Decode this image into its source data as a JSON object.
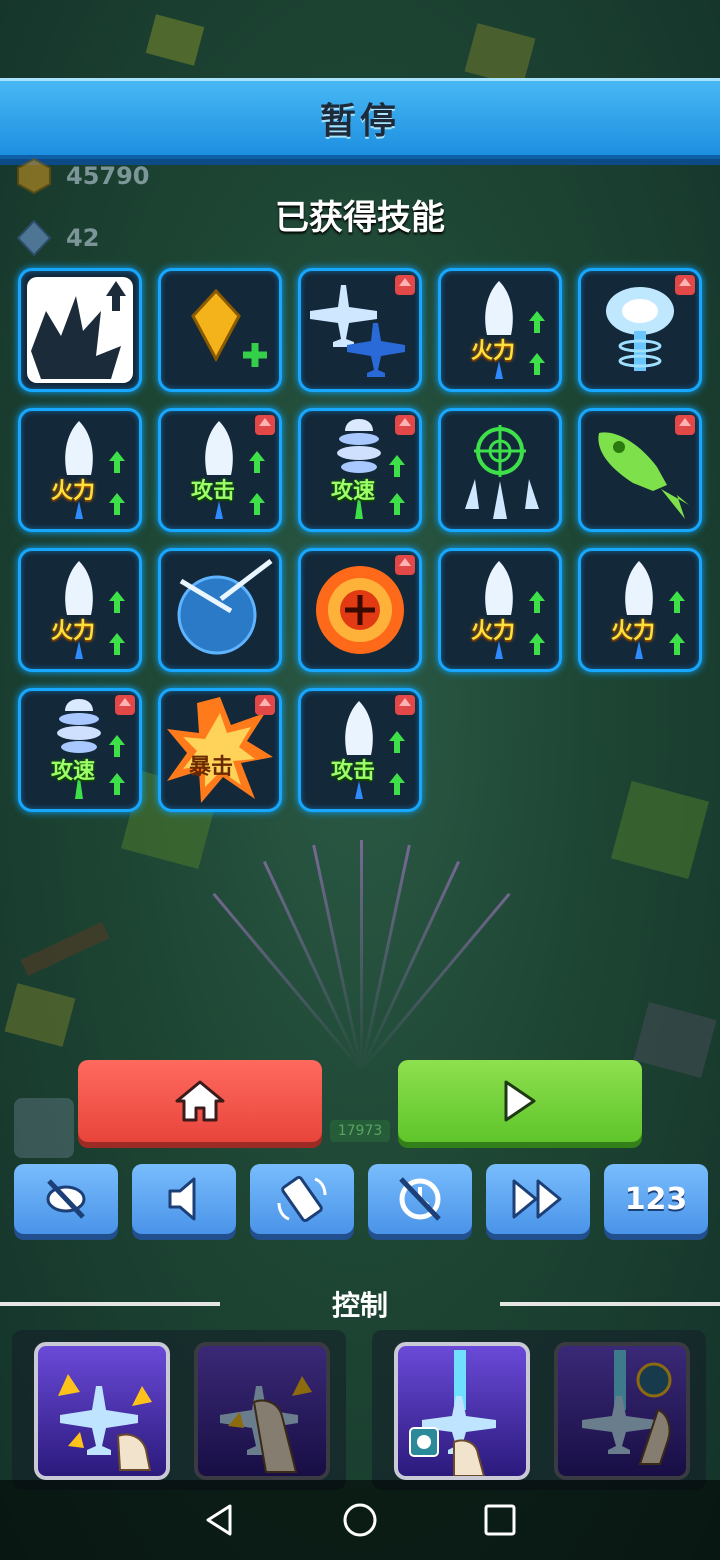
{
  "title": "暂停",
  "resources": {
    "coins": "45790",
    "gems": "42"
  },
  "skills_title": "已获得技能",
  "skills": [
    {
      "icon": "explosion-icon",
      "label": "",
      "upgrade": false
    },
    {
      "icon": "gem-plus-icon",
      "label": "",
      "upgrade": false
    },
    {
      "icon": "wingman-planes-icon",
      "label": "",
      "upgrade": true
    },
    {
      "icon": "missile-icon",
      "label": "火力",
      "upgrade": false
    },
    {
      "icon": "energy-burst-icon",
      "label": "",
      "upgrade": true
    },
    {
      "icon": "missile-icon",
      "label": "火力",
      "upgrade": false
    },
    {
      "icon": "missile-icon",
      "label": "攻击",
      "upgrade": true
    },
    {
      "icon": "drill-icon",
      "label": "攻速",
      "upgrade": true
    },
    {
      "icon": "target-missiles-icon",
      "label": "",
      "upgrade": false
    },
    {
      "icon": "green-rocket-icon",
      "label": "",
      "upgrade": true
    },
    {
      "icon": "missile-icon",
      "label": "火力",
      "upgrade": false
    },
    {
      "icon": "shield-orb-icon",
      "label": "",
      "upgrade": false
    },
    {
      "icon": "fire-ring-icon",
      "label": "",
      "upgrade": true
    },
    {
      "icon": "missile-icon",
      "label": "火力",
      "upgrade": false
    },
    {
      "icon": "missile-icon",
      "label": "火力",
      "upgrade": false
    },
    {
      "icon": "drill-icon",
      "label": "攻速",
      "upgrade": true
    },
    {
      "icon": "crit-burst-icon",
      "label": "暴击",
      "upgrade": true
    },
    {
      "icon": "missile-icon",
      "label": "攻击",
      "upgrade": true
    }
  ],
  "background_counter": "17973",
  "settings_buttons": [
    {
      "icon": "vibration-off-icon"
    },
    {
      "icon": "sound-icon"
    },
    {
      "icon": "phone-rotate-icon"
    },
    {
      "icon": "auto-rotate-off-icon"
    },
    {
      "icon": "fast-forward-icon"
    },
    {
      "icon": "number-display-icon",
      "label": "123"
    }
  ],
  "control_label": "控制",
  "control_options": [
    {
      "icon": "drag-move-icon",
      "selected": true
    },
    {
      "icon": "drag-move-icon",
      "selected": false
    },
    {
      "icon": "tap-shoot-icon",
      "selected": true
    },
    {
      "icon": "tap-shoot-icon",
      "selected": false
    }
  ],
  "colors": {
    "accent_blue": "#17a7ff",
    "home_red": "#e8453c",
    "play_green": "#5fc52b",
    "settings_blue": "#4a93e8"
  }
}
